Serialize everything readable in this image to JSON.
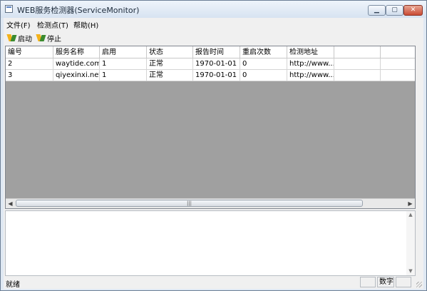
{
  "window": {
    "title": "WEB服务检测器(ServiceMonitor)"
  },
  "titlebar_controls": [
    "▁",
    "▢",
    "✕"
  ],
  "menu": [
    "文件(F)",
    "检测点(T)",
    "帮助(H)"
  ],
  "toolbar": {
    "start_label": "启动",
    "stop_label": "停止"
  },
  "table": {
    "columns": [
      "编号",
      "服务名称",
      "启用",
      "状态",
      "报告时间",
      "重启次数",
      "检测地址",
      "",
      ""
    ],
    "rows": [
      [
        "2",
        "waytide.com",
        "1",
        "正常",
        "1970-01-01 ...",
        "0",
        "http://www....",
        "",
        ""
      ],
      [
        "3",
        "qiyexinxi.net",
        "1",
        "正常",
        "1970-01-01 ...",
        "0",
        "http://www....",
        "",
        ""
      ]
    ]
  },
  "status": {
    "text": "就绪",
    "panes": [
      "",
      "数字",
      ""
    ]
  }
}
